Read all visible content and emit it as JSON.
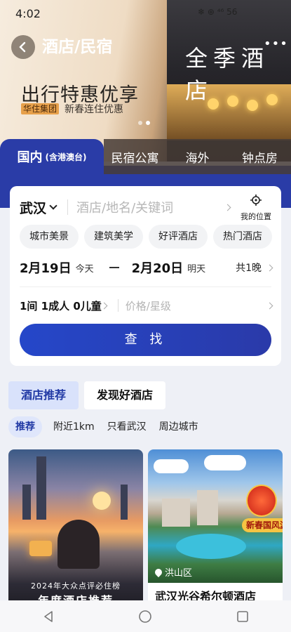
{
  "status": {
    "time": "4:02",
    "right": "❄ ⊕ ⁴⁶ 56"
  },
  "header": {
    "title": "酒店/民宿"
  },
  "promo": {
    "title": "出行特惠优享",
    "brand": "华住集团",
    "subtitle": "新春连住优惠",
    "sign_text": "全季酒店"
  },
  "tabs": [
    {
      "label": "国内",
      "hint": "(含港澳台)"
    },
    {
      "label": "民宿公寓"
    },
    {
      "label": "海外"
    },
    {
      "label": "钟点房"
    }
  ],
  "search": {
    "city": "武汉",
    "keyword_placeholder": "酒店/地名/关键词",
    "locate_label": "我的位置",
    "chips": [
      "城市美景",
      "建筑美学",
      "好评酒店",
      "热门酒店"
    ],
    "checkin_date": "2月19日",
    "checkin_label": "今天",
    "checkout_date": "2月20日",
    "checkout_label": "明天",
    "nights": "共1晚",
    "guests": "1间 1成人 0儿童",
    "price_placeholder": "价格/星级",
    "button_label": "查 找"
  },
  "recommend": {
    "tabs": [
      "酒店推荐",
      "发现好酒店"
    ],
    "filters": [
      "推荐",
      "附近1km",
      "只看武汉",
      "周边城市"
    ]
  },
  "hotels": [
    {
      "award_line1": "2024年大众点评必住榜",
      "award_line2": "年度酒店推荐"
    },
    {
      "district": "洪山区",
      "name": "武汉光谷希尔顿酒店",
      "badge": "新春国风游"
    }
  ],
  "colors": {
    "primary": "#2a3ca7",
    "chip_bg": "#f2f3f5"
  }
}
